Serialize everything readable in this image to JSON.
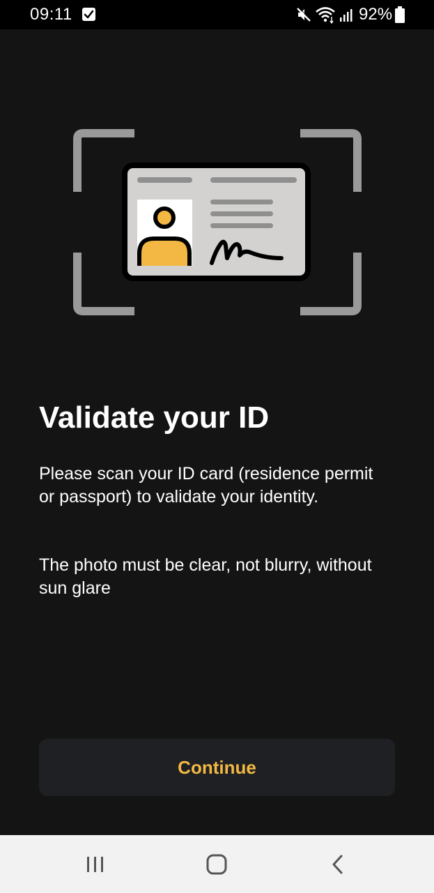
{
  "status_bar": {
    "time": "09:11",
    "battery_percent": "92%",
    "icons": [
      "checkbox-notification-icon",
      "mute-icon",
      "wifi-icon",
      "signal-icon",
      "battery-icon"
    ]
  },
  "illustration": {
    "icon": "id-card-scan-icon",
    "colors": {
      "frame": "#9a9a9a",
      "card": "#d3d2d1",
      "avatar": "#f2b843",
      "card_border": "#000000"
    }
  },
  "content": {
    "title": "Validate your ID",
    "paragraph_1": "Please scan your ID card (residence permit or passport) to validate your identity.",
    "paragraph_2": "The photo must be clear, not blurry, without sun glare"
  },
  "actions": {
    "continue_label": "Continue",
    "accent_color": "#f2b843"
  },
  "nav_bar": {
    "icons": [
      "recents-icon",
      "home-icon",
      "back-icon"
    ]
  }
}
